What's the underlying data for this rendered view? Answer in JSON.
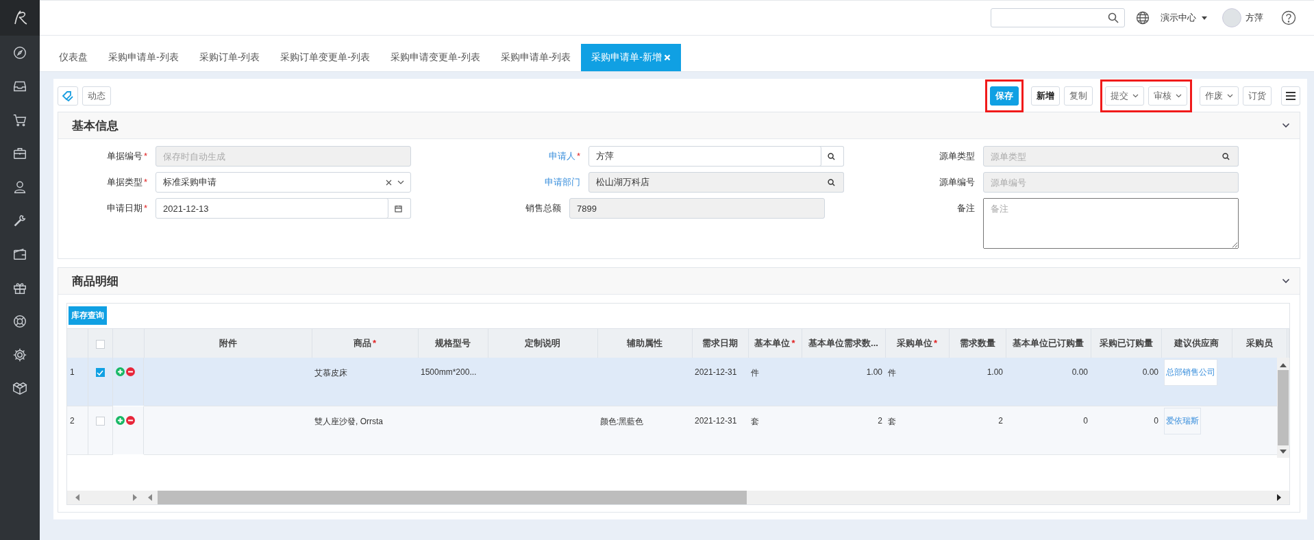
{
  "header": {
    "org": "演示中心",
    "user": "方萍"
  },
  "tabs": [
    {
      "label": "仪表盘",
      "selected": false,
      "closable": false
    },
    {
      "label": "采购申请单-列表",
      "selected": false,
      "closable": false
    },
    {
      "label": "采购订单-列表",
      "selected": false,
      "closable": false
    },
    {
      "label": "采购订单变更单-列表",
      "selected": false,
      "closable": false
    },
    {
      "label": "采购申请变更单-列表",
      "selected": false,
      "closable": false
    },
    {
      "label": "采购申请单-列表",
      "selected": false,
      "closable": false
    },
    {
      "label": "采购申请单-新增",
      "selected": true,
      "closable": true
    }
  ],
  "toolbar": {
    "left_button": "动态",
    "groups": [
      {
        "highlighted": true,
        "buttons": [
          {
            "label": "保存",
            "kind": "primary",
            "dropdown": false
          }
        ]
      },
      {
        "highlighted": false,
        "buttons": [
          {
            "label": "新增",
            "kind": "bold",
            "dropdown": false
          },
          {
            "label": "复制",
            "kind": "plain",
            "dropdown": false
          }
        ]
      },
      {
        "highlighted": true,
        "buttons": [
          {
            "label": "提交",
            "kind": "plain",
            "dropdown": true
          },
          {
            "label": "审核",
            "kind": "plain",
            "dropdown": true
          }
        ]
      },
      {
        "highlighted": false,
        "buttons": [
          {
            "label": "作废",
            "kind": "plain",
            "dropdown": true
          },
          {
            "label": "订货",
            "kind": "plain",
            "dropdown": false
          }
        ]
      }
    ]
  },
  "basic_info": {
    "title": "基本信息",
    "expanded": true,
    "columns": [
      [
        {
          "label": "单据编号",
          "required_mark": "*",
          "link": false,
          "placeholder": "保存时自动生成",
          "disabled": true,
          "kind": "text"
        },
        {
          "label": "单据类型",
          "required_mark": "*",
          "link": false,
          "value": "标准采购申请",
          "disabled": false,
          "kind": "select"
        },
        {
          "label": "申请日期",
          "required_mark": "*",
          "link": false,
          "value": "2021-12-13",
          "disabled": false,
          "kind": "date"
        }
      ],
      [
        {
          "label": "申请人",
          "required_mark": "*",
          "link": true,
          "value": "方萍",
          "disabled": false,
          "kind": "lookup"
        },
        {
          "label": "申请部门",
          "link": true,
          "value": "松山湖万科店",
          "disabled": true,
          "kind": "lookup"
        },
        {
          "label": "销售总额",
          "link": false,
          "value": "7899",
          "disabled": true,
          "kind": "text"
        }
      ],
      [
        {
          "label": "源单类型",
          "link": false,
          "placeholder": "源单类型",
          "disabled": true,
          "kind": "lookup"
        },
        {
          "label": "源单编号",
          "link": false,
          "placeholder": "源单编号",
          "disabled": true,
          "kind": "text"
        },
        {
          "label": "备注",
          "link": false,
          "placeholder": "备注",
          "disabled": false,
          "kind": "textarea"
        }
      ]
    ]
  },
  "details": {
    "title": "商品明细",
    "expanded": true,
    "stock_button": "库存查询",
    "all_checked": false,
    "columns": [
      {
        "label": "附件"
      },
      {
        "label": "商品",
        "required_mark": "*"
      },
      {
        "label": "规格型号"
      },
      {
        "label": "定制说明"
      },
      {
        "label": "辅助属性"
      },
      {
        "label": "需求日期"
      },
      {
        "label": "基本单位",
        "required_mark": "*"
      },
      {
        "label": "基本单位需求数..."
      },
      {
        "label": "采购单位",
        "required_mark": "*"
      },
      {
        "label": "需求数量"
      },
      {
        "label": "基本单位已订购量"
      },
      {
        "label": "采购已订购量"
      },
      {
        "label": "建议供应商"
      },
      {
        "label": "采购员"
      }
    ],
    "rows": [
      {
        "number": "1",
        "selected": true,
        "product": "艾慕皮床",
        "spec": "1500mm*200...",
        "date": "2021-12-31",
        "base_unit": "件",
        "base_qty": "1.00",
        "purchase_unit": "件",
        "qty": "1.00",
        "base_ordered": "0.00",
        "ordered": "0.00",
        "supplier": "总部销售公司"
      },
      {
        "number": "2",
        "selected": false,
        "product": "雙人座沙發, Orrsta",
        "attribute": "颜色:黑藍色",
        "date": "2021-12-31",
        "base_unit": "套",
        "base_qty": "2",
        "purchase_unit": "套",
        "qty": "2",
        "base_ordered": "0",
        "ordered": "0",
        "supplier": "爱依瑞斯"
      }
    ]
  }
}
